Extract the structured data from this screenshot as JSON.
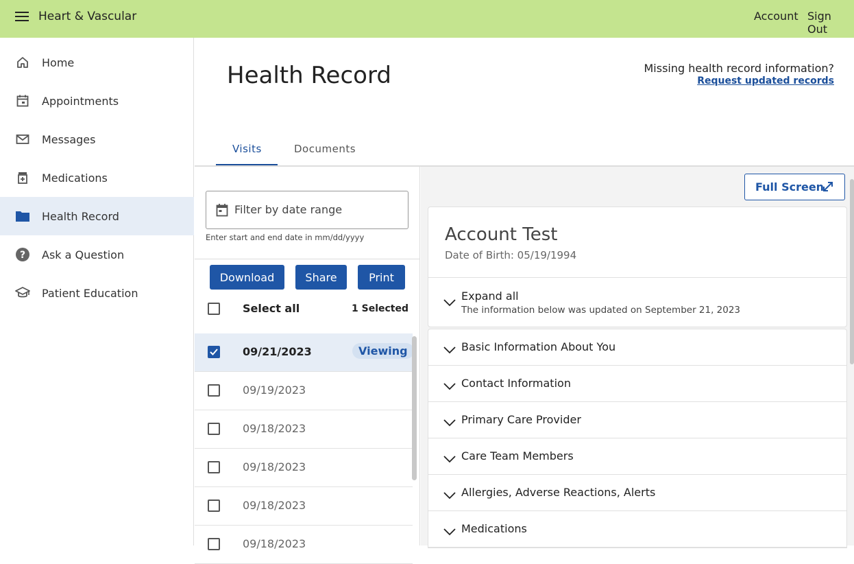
{
  "header": {
    "app_title": "Heart & Vascular",
    "account_label": "Account",
    "signout_label": "Sign Out"
  },
  "sidebar": {
    "items": [
      {
        "label": "Home",
        "icon": "home-icon"
      },
      {
        "label": "Appointments",
        "icon": "calendar-icon"
      },
      {
        "label": "Messages",
        "icon": "mail-icon"
      },
      {
        "label": "Medications",
        "icon": "medication-icon"
      },
      {
        "label": "Health Record",
        "icon": "folder-icon",
        "active": true
      },
      {
        "label": "Ask a Question",
        "icon": "question-icon"
      },
      {
        "label": "Patient Education",
        "icon": "graduation-cap-icon"
      }
    ]
  },
  "main": {
    "title": "Health Record",
    "missing_text": "Missing health record information?",
    "request_link": "Request updated records",
    "tabs": [
      {
        "label": "Visits",
        "active": true
      },
      {
        "label": "Documents",
        "active": false
      }
    ]
  },
  "visits": {
    "filter_placeholder": "Filter by date range",
    "filter_hint": "Enter start and end date in mm/dd/yyyy",
    "download_label": "Download",
    "share_label": "Share",
    "print_label": "Print",
    "select_all_label": "Select all",
    "selected_count": "1 Selected",
    "viewing_label": "Viewing",
    "rows": [
      {
        "date": "09/21/2023",
        "checked": true,
        "viewing": true
      },
      {
        "date": "09/19/2023",
        "checked": false
      },
      {
        "date": "09/18/2023",
        "checked": false
      },
      {
        "date": "09/18/2023",
        "checked": false
      },
      {
        "date": "09/18/2023",
        "checked": false
      },
      {
        "date": "09/18/2023",
        "checked": false
      }
    ]
  },
  "record": {
    "fullscreen_label": "Full Screen",
    "patient_name": "Account Test",
    "dob": "Date of Birth: 05/19/1994",
    "expand_all": "Expand all",
    "updated_text": "The information below was updated on September 21, 2023",
    "sections": [
      "Basic Information About You",
      "Contact Information",
      "Primary Care Provider",
      "Care Team Members",
      "Allergies, Adverse Reactions, Alerts",
      "Medications"
    ]
  },
  "colors": {
    "topbar": "#c4e48f",
    "primary": "#1f56a6",
    "active_bg": "#e6edf6"
  }
}
